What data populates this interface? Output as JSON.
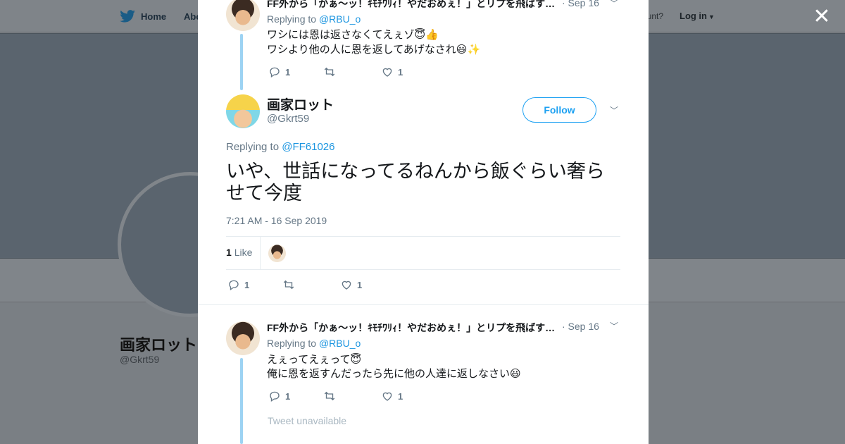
{
  "background": {
    "nav": {
      "home": "Home",
      "about": "Abo",
      "account_text": "ccount?",
      "login": "Log in"
    },
    "profile": {
      "name": "画家ロット",
      "handle": "@Gkrt59"
    }
  },
  "modal": {
    "close_label": "✕",
    "tweets": [
      {
        "author_line": "FF外から「かぁ〜ッ！ｷﾓﾁﾜﾘｨ！やだおめぇ！」とリプを飛ばす…",
        "date": "· Sep 16",
        "replying_prefix": "Replying to ",
        "replying_to": "@RBU_o",
        "lines": [
          "ワシには恩は返さなくてえぇゾ😇👍",
          "ワシより他の人に恩を返してあげなされ😃✨"
        ],
        "reply_count": "1",
        "retweet_count": "",
        "like_count": "1"
      },
      {
        "author_line": "FF外から「かぁ〜ッ！ｷﾓﾁﾜﾘｨ！やだおめぇ！」とリプを飛ばす…",
        "date": "· Sep 16",
        "replying_prefix": "Replying to ",
        "replying_to": "@RBU_o",
        "lines": [
          "えぇってえぇって😇",
          "俺に恩を返すんだったら先に他の人達に返しなさい😃"
        ],
        "reply_count": "1",
        "retweet_count": "",
        "like_count": "1"
      }
    ],
    "main_tweet": {
      "name": "画家ロット",
      "handle": "@Gkrt59",
      "follow_label": "Follow",
      "replying_prefix": "Replying to ",
      "replying_to": "@FF61026",
      "text": "いや、世話になってるねんから飯ぐらい奢らせて今度",
      "timestamp": "7:21 AM - 16 Sep 2019",
      "likes_count": "1",
      "likes_label": "Like",
      "reply_count": "1",
      "like_count": "1"
    },
    "unavailable_text": "Tweet unavailable",
    "colors": {
      "accent": "#1da1f2",
      "mention": "#1b95e0",
      "thread_line": "#9dd3f3",
      "muted": "#657786"
    }
  }
}
